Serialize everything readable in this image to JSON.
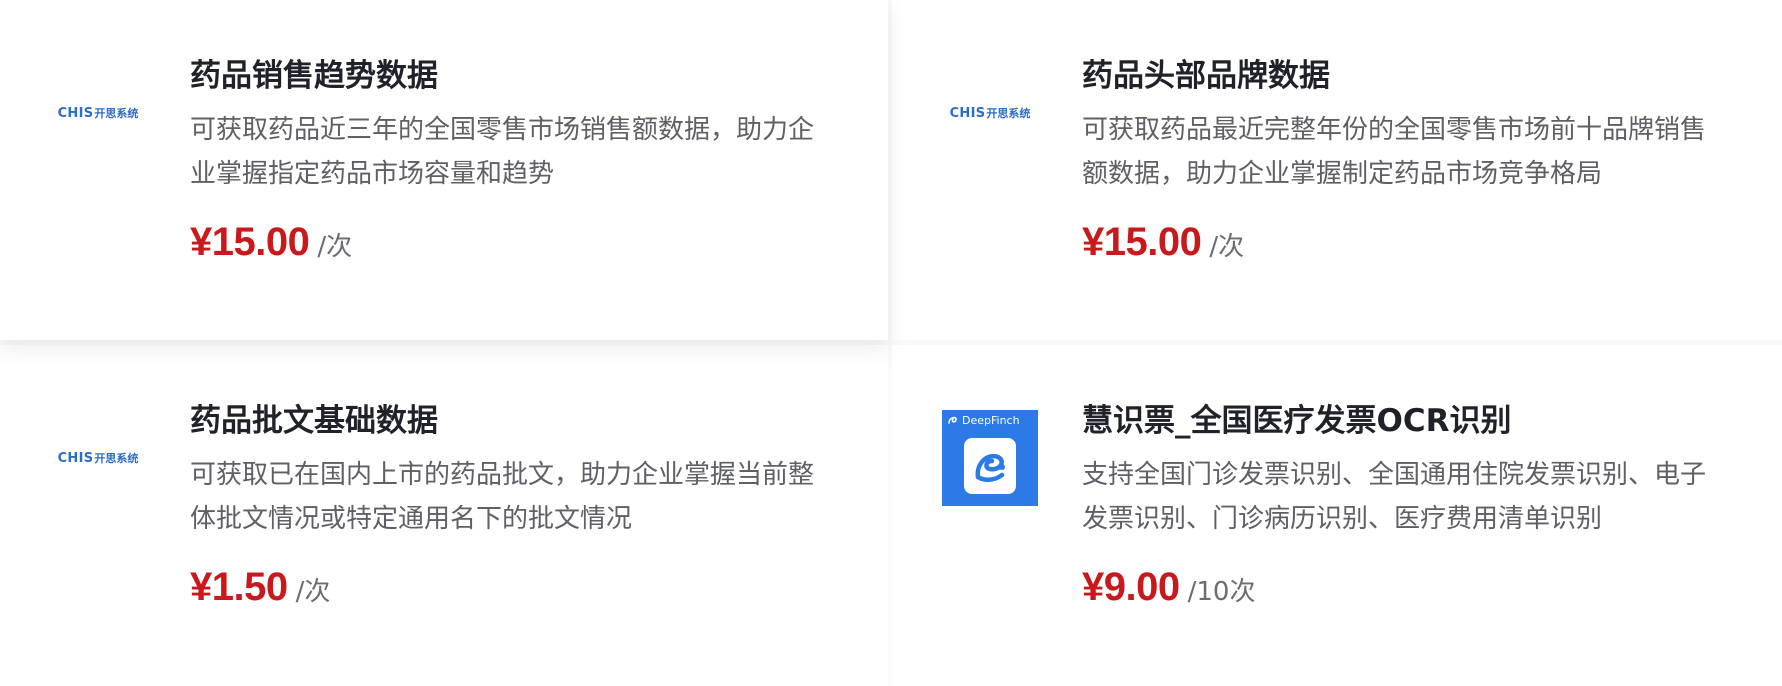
{
  "products": [
    {
      "logo": "chis-logo",
      "logo_en": "CHIS",
      "logo_cn": "开思系统",
      "title": "药品销售趋势数据",
      "description": "可获取药品近三年的全国零售市场销售额数据，助力企业掌握指定药品市场容量和趋势",
      "price": "¥15.00",
      "unit": "/次"
    },
    {
      "logo": "chis-logo",
      "logo_en": "CHIS",
      "logo_cn": "开思系统",
      "title": "药品头部品牌数据",
      "description": "可获取药品最近完整年份的全国零售市场前十品牌销售额数据，助力企业掌握制定药品市场竞争格局",
      "price": "¥15.00",
      "unit": "/次"
    },
    {
      "logo": "chis-logo",
      "logo_en": "CHIS",
      "logo_cn": "开思系统",
      "title": "药品批文基础数据",
      "description": "可获取已在国内上市的药品批文，助力企业掌握当前整体批文情况或特定通用名下的批文情况",
      "price": "¥1.50",
      "unit": "/次"
    },
    {
      "logo": "deepfinch-logo",
      "logo_text": "DeepFinch",
      "title": "慧识票_全国医疗发票OCR识别",
      "description": "支持全国门诊发票识别、全国通用住院发票识别、电子发票识别、门诊病历识别、医疗费用清单识别",
      "price": "¥9.00",
      "unit": "/10次"
    }
  ],
  "colors": {
    "price": "#c8191d",
    "title": "#1f2329",
    "description": "#5e6065",
    "chis_brand": "#2f6cc4",
    "deepfinch_brand": "#2b7ae5"
  }
}
